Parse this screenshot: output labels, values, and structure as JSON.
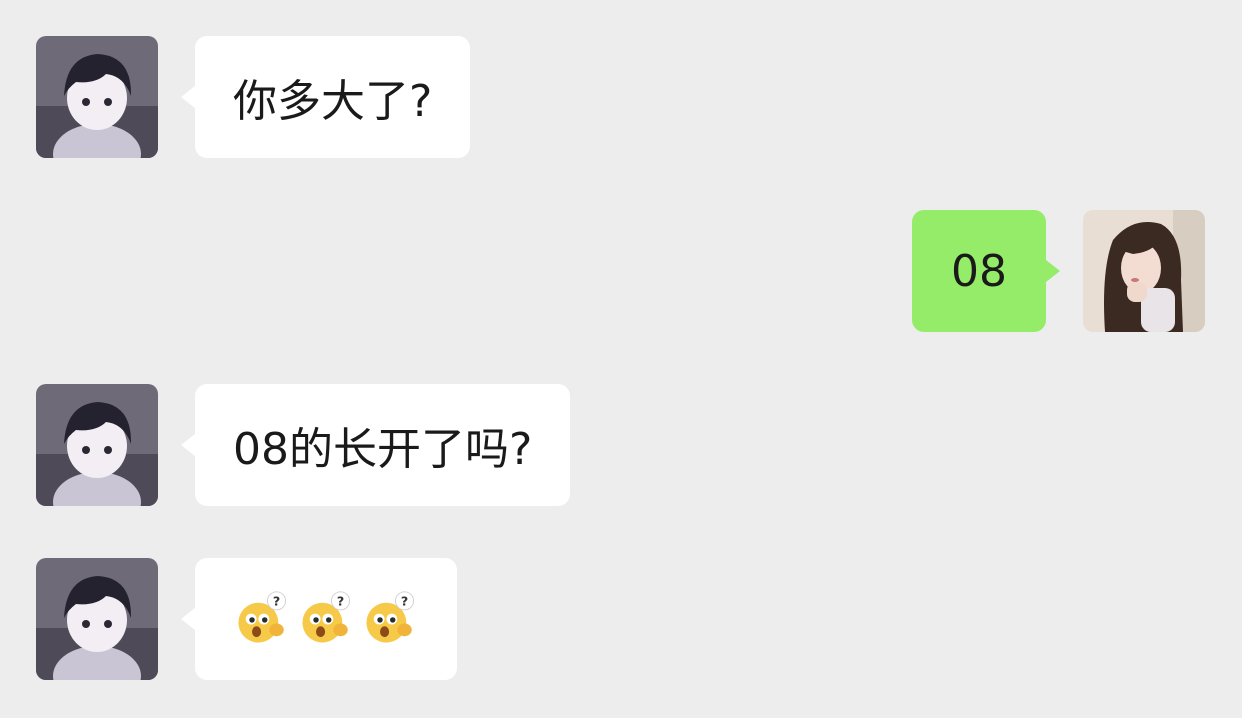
{
  "messages": [
    {
      "side": "in",
      "text": "你多大了?"
    },
    {
      "side": "out",
      "text": "08"
    },
    {
      "side": "in",
      "text": "08的长开了吗?"
    },
    {
      "side": "in",
      "emoji": [
        "confused-face-emoji",
        "confused-face-emoji",
        "confused-face-emoji"
      ]
    }
  ],
  "colors": {
    "background": "#ededed",
    "incoming_bubble": "#ffffff",
    "outgoing_bubble": "#95ec69"
  }
}
